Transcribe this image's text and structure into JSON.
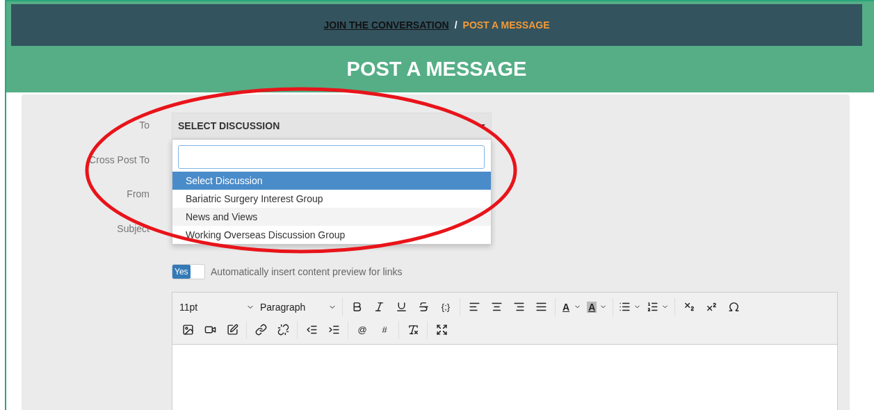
{
  "breadcrumb": [
    {
      "label": "JOIN THE CONVERSATION",
      "kind": "link"
    },
    {
      "label": "POST A MESSAGE",
      "kind": "current"
    }
  ],
  "breadcrumb_separator": "/",
  "page_title": "POST A MESSAGE",
  "form": {
    "labels": [
      "To",
      "Cross Post To",
      "From",
      "Subject"
    ],
    "to_select": {
      "value": "SELECT DISCUSSION",
      "expanded": true
    },
    "dropdown": {
      "options": [
        {
          "label": "Select Discussion",
          "selected": true
        },
        {
          "label": "Bariatric Surgery Interest Group",
          "selected": false
        },
        {
          "label": "News and Views",
          "selected": false
        },
        {
          "label": "Working Overseas Discussion Group",
          "selected": false
        }
      ]
    },
    "preview_toggle": {
      "label": "Yes",
      "on": true,
      "text": "Automatically insert content preview for links"
    }
  },
  "toolbar": [
    [
      {
        "kind": "select",
        "label": "11pt"
      },
      {
        "kind": "select",
        "label": "Paragraph"
      },
      {
        "kind": "sep"
      },
      {
        "kind": "icon"
      },
      {
        "kind": "icon"
      },
      {
        "kind": "icon"
      },
      {
        "kind": "icon"
      },
      {
        "kind": "text",
        "label": "{;}"
      },
      {
        "kind": "sep"
      },
      {
        "kind": "icon"
      },
      {
        "kind": "icon"
      },
      {
        "kind": "icon"
      },
      {
        "kind": "icon"
      },
      {
        "kind": "sep"
      },
      {
        "kind": "color",
        "label": "A"
      },
      {
        "kind": "highlight",
        "label": "A"
      },
      {
        "kind": "sep"
      },
      {
        "kind": "split"
      },
      {
        "kind": "split"
      },
      {
        "kind": "sep"
      },
      {
        "kind": "icon"
      },
      {
        "kind": "icon"
      },
      {
        "kind": "icon"
      }
    ],
    [
      {
        "kind": "icon"
      },
      {
        "kind": "icon"
      },
      {
        "kind": "icon"
      },
      {
        "kind": "sep"
      },
      {
        "kind": "icon"
      },
      {
        "kind": "icon"
      },
      {
        "kind": "sep"
      },
      {
        "kind": "icon"
      },
      {
        "kind": "icon"
      },
      {
        "kind": "sep"
      },
      {
        "kind": "text",
        "label": "@"
      },
      {
        "kind": "text",
        "label": "#"
      },
      {
        "kind": "sep"
      },
      {
        "kind": "icon"
      },
      {
        "kind": "sep"
      },
      {
        "kind": "icon"
      }
    ]
  ]
}
